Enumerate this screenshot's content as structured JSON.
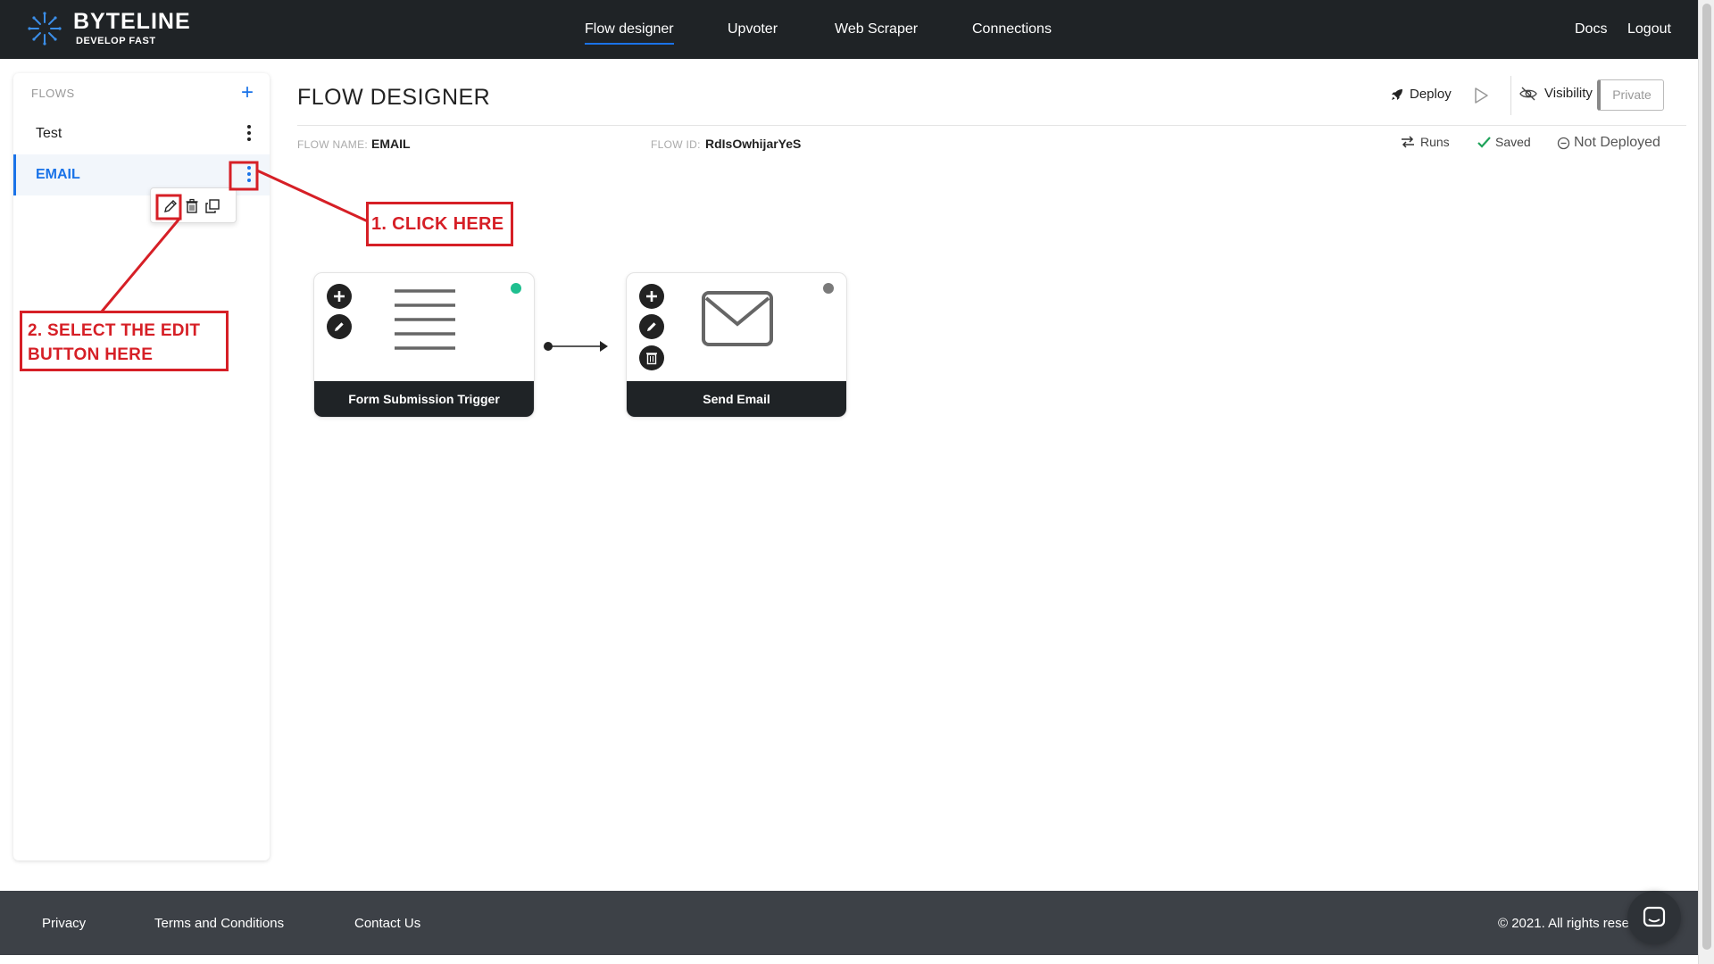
{
  "app": {
    "logo_name": "BYTELINE",
    "logo_tagline": "DEVELOP FAST",
    "accent_color": "#1a73e8"
  },
  "nav": {
    "items": [
      {
        "label": "Flow designer",
        "active": true
      },
      {
        "label": "Upvoter"
      },
      {
        "label": "Web Scraper"
      },
      {
        "label": "Connections"
      }
    ],
    "docs_label": "Docs",
    "logout_label": "Logout"
  },
  "sidebar": {
    "heading": "FLOWS",
    "add_icon": "plus-icon",
    "flows": [
      {
        "label": "Test"
      },
      {
        "label": "EMAIL",
        "active": true
      }
    ],
    "actions": [
      "edit-icon",
      "trash-icon",
      "copy-icon"
    ]
  },
  "main": {
    "title": "FLOW DESIGNER",
    "deploy_label": "Deploy",
    "visibility_label": "Visibility",
    "private_label": "Private",
    "flow_name_label": "FLOW NAME:",
    "flow_name_value": "EMAIL",
    "flow_id_label": "FLOW ID:",
    "flow_id_value": "RdIsOwhijarYeS",
    "runs_label": "Runs",
    "saved_label": "Saved",
    "deploy_status": "Not Deployed"
  },
  "nodes": [
    {
      "title": "Form Submission Trigger",
      "icon": "form-lines-icon",
      "status_color": "#1fbf8f"
    },
    {
      "title": "Send Email",
      "icon": "envelope-icon",
      "status_color": "#7a7a7a"
    }
  ],
  "annotations": {
    "step1": "1. CLICK HERE",
    "step2_line1": "2. SELECT THE EDIT",
    "step2_line2": "BUTTON HERE",
    "color": "#d61f26"
  },
  "footer": {
    "privacy": "Privacy",
    "terms": "Terms and Conditions",
    "contact": "Contact Us",
    "copyright": "© 2021. All rights reser"
  }
}
